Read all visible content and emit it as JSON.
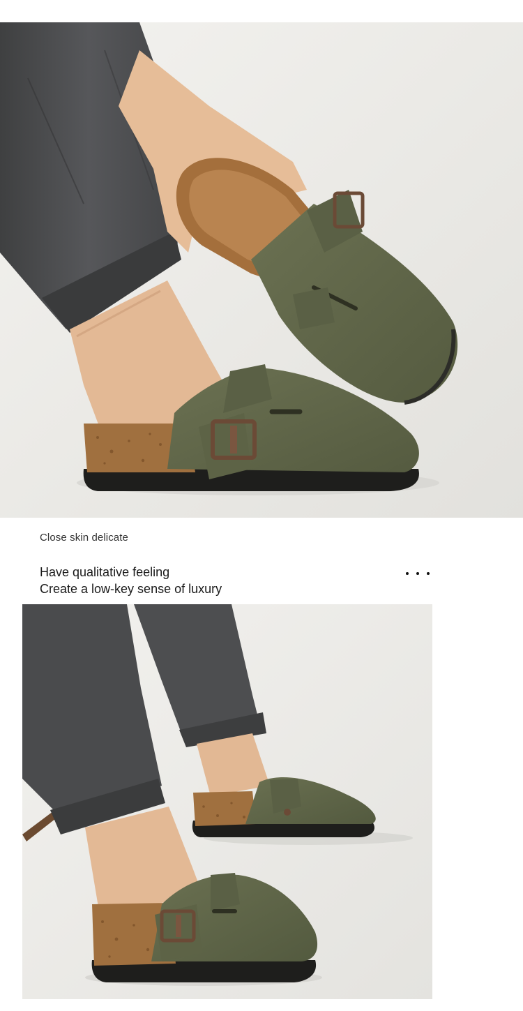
{
  "caption": "Close skin delicate",
  "headline": {
    "line1": "Have qualitative feeling",
    "line2": "Create a low-key sense of luxury"
  },
  "icons": {
    "more": "more-dots-icon"
  },
  "colors": {
    "suede_olive": "#5f6648",
    "cork": "#a0703f",
    "sole": "#1e1e1c",
    "pants": "#4b4c4d",
    "skin": "#e2b894",
    "buckle": "#6b4a36",
    "background": "#ecebe8"
  }
}
